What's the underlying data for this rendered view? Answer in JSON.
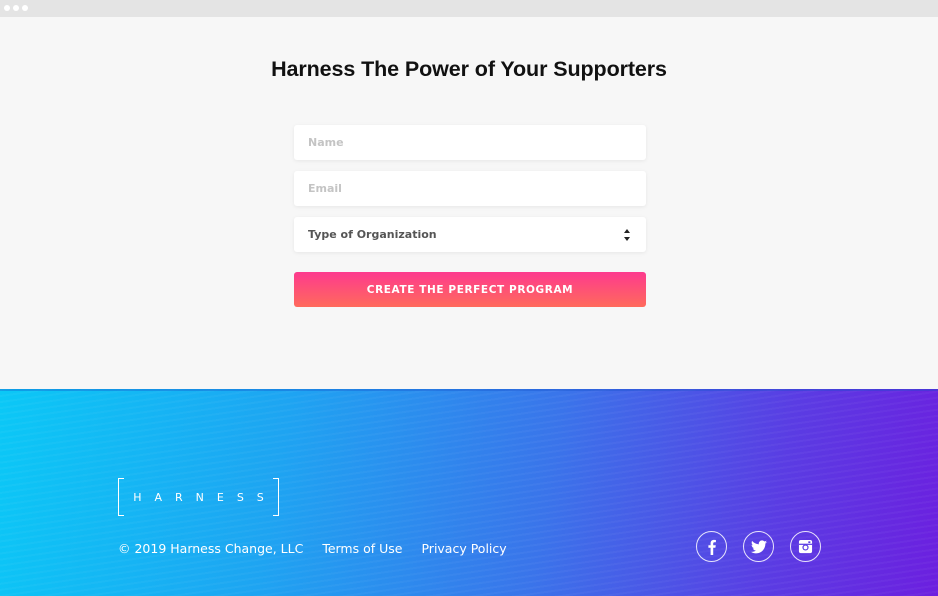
{
  "window": {
    "controls": [
      "dot",
      "dot",
      "dot"
    ]
  },
  "main": {
    "headline": "Harness The Power of Your Supporters",
    "form": {
      "name_placeholder": "Name",
      "email_placeholder": "Email",
      "organization_select": {
        "selected_label": "Type of Organization",
        "icon": "sort-arrows-icon"
      },
      "submit_label": "CREATE THE PERFECT PROGRAM"
    }
  },
  "footer": {
    "logo_text": "HARNESS",
    "copyright": "© 2019 Harness Change, LLC",
    "links": [
      {
        "label": "Terms of Use"
      },
      {
        "label": "Privacy Policy"
      }
    ],
    "social": [
      {
        "name": "facebook",
        "icon": "facebook-icon"
      },
      {
        "name": "twitter",
        "icon": "twitter-icon"
      },
      {
        "name": "instagram",
        "icon": "instagram-icon"
      }
    ]
  },
  "colors": {
    "cta_gradient_top": "#fd3a8e",
    "cta_gradient_bottom": "#ff6a5c",
    "footer_gradient_start": "#0bc8f6",
    "footer_gradient_mid": "#3a74ea",
    "footer_gradient_end": "#6c1fdf",
    "page_background": "#f7f7f7"
  }
}
